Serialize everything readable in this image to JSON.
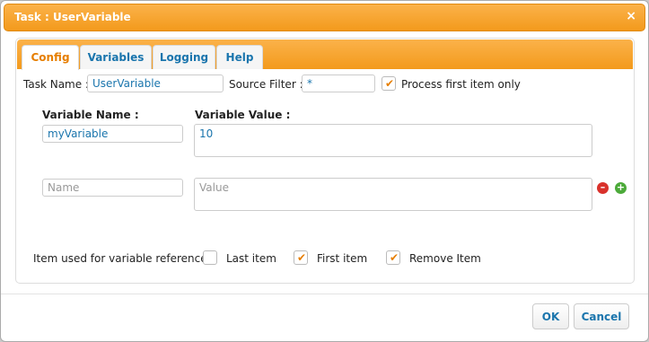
{
  "dialog": {
    "title": "Task : UserVariable",
    "close_icon": "×"
  },
  "tabs": [
    {
      "label": "Config",
      "active": true
    },
    {
      "label": "Variables",
      "active": false
    },
    {
      "label": "Logging",
      "active": false
    },
    {
      "label": "Help",
      "active": false
    }
  ],
  "task": {
    "name_label": "Task Name :",
    "name_value": "UserVariable",
    "source_filter_label": "Source Filter :",
    "source_filter_value": "*",
    "process_first_label": "Process first item only",
    "process_first_checked": true
  },
  "variables": {
    "name_header": "Variable Name :",
    "value_header": "Variable Value :",
    "row1_name": "myVariable",
    "row1_value": "10",
    "new_name_placeholder": "Name",
    "new_value_placeholder": "Value"
  },
  "reference": {
    "label": "Item used for variable reference :",
    "last_item_label": "Last item",
    "last_item_checked": false,
    "first_item_label": "First item",
    "first_item_checked": true,
    "remove_item_label": "Remove Item",
    "remove_item_checked": true
  },
  "buttons": {
    "ok": "OK",
    "cancel": "Cancel"
  },
  "colors": {
    "accent": "#f39a1c",
    "link": "#1a75ad",
    "remove_icon": "#d9312b",
    "add_icon": "#4caa3a"
  },
  "icons": {
    "remove_row": "remove-icon",
    "add_row": "add-icon"
  }
}
